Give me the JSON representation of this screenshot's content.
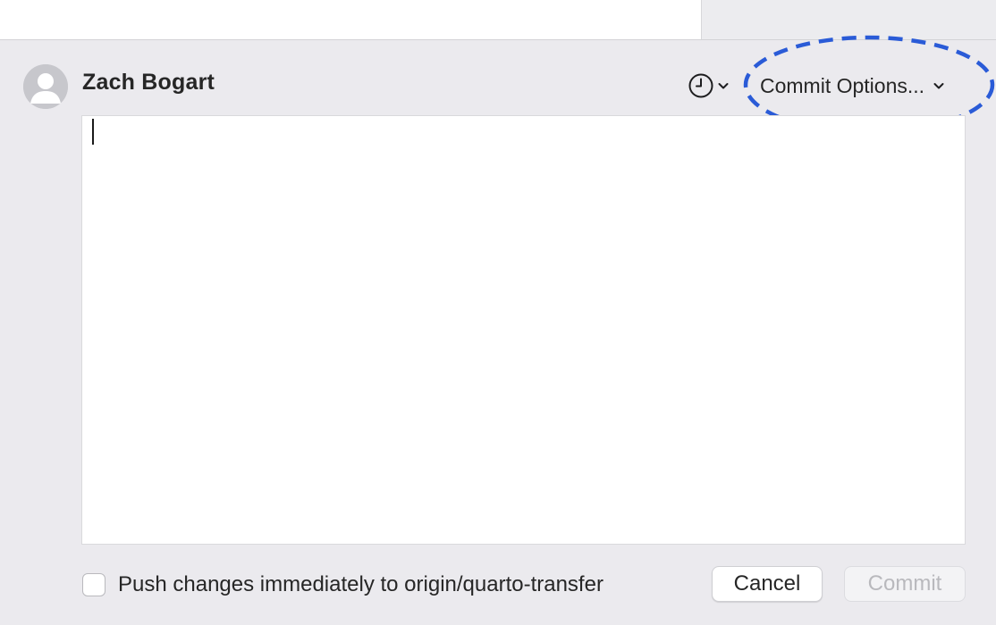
{
  "author": {
    "name": "Zach Bogart",
    "avatar_icon": "user-silhouette-icon"
  },
  "header": {
    "history_icon": "clock-icon",
    "history_chevron_icon": "chevron-down-icon",
    "commit_options_label": "Commit Options...",
    "commit_options_chevron_icon": "chevron-down-icon",
    "highlight_color": "#2a5bd7"
  },
  "message": {
    "value": ""
  },
  "footer": {
    "push_checkbox_checked": false,
    "push_label": "Push changes immediately to origin/quarto-transfer",
    "cancel_label": "Cancel",
    "commit_label": "Commit",
    "commit_enabled": false
  }
}
